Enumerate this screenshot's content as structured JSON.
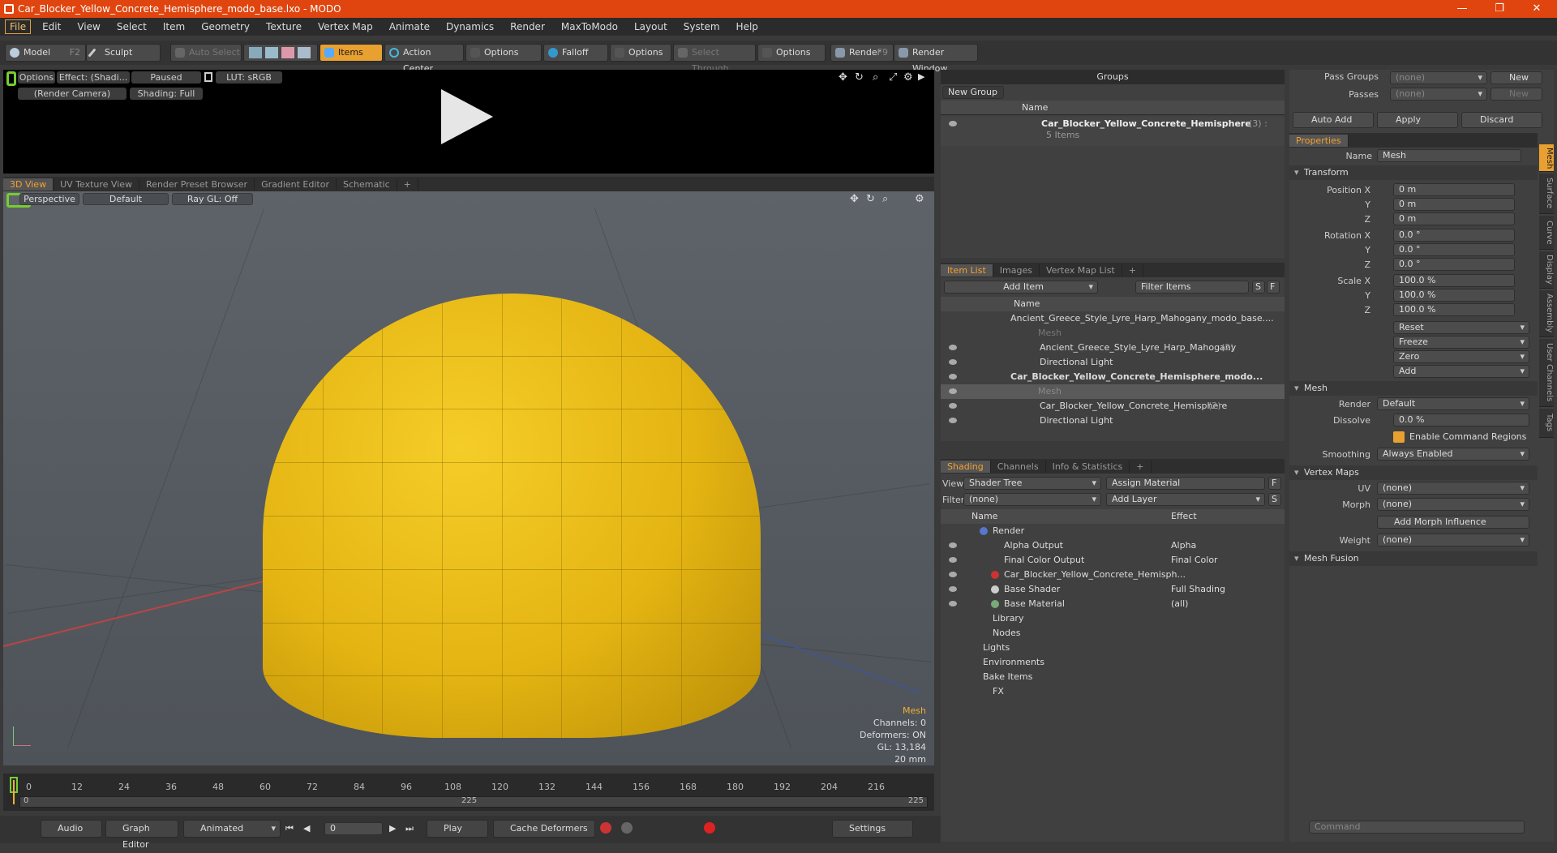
{
  "window": {
    "title": "Car_Blocker_Yellow_Concrete_Hemisphere_modo_base.lxo - MODO",
    "min": "—",
    "max": "❐",
    "close": "✕"
  },
  "menu": [
    "File",
    "Edit",
    "View",
    "Select",
    "Item",
    "Geometry",
    "Texture",
    "Vertex Map",
    "Animate",
    "Dynamics",
    "Render",
    "MaxToModo",
    "Layout",
    "System",
    "Help"
  ],
  "toolbar": {
    "model": "Model",
    "model_key": "F2",
    "sculpt": "Sculpt",
    "auto_select": "Auto Select",
    "items": "Items",
    "action_center": "Action Center",
    "options1": "Options",
    "falloff": "Falloff",
    "options2": "Options",
    "select_through": "Select Through",
    "options3": "Options",
    "render": "Render",
    "render_key": "F9",
    "render_window": "Render Window"
  },
  "preview": {
    "options": "Options",
    "effect": "Effect: (Shadi...",
    "paused": "Paused",
    "lut": "LUT: sRGB",
    "camera": "(Render Camera)",
    "shading": "Shading: Full"
  },
  "view_tabs": [
    "3D View",
    "UV Texture View",
    "Render Preset Browser",
    "Gradient Editor",
    "Schematic",
    "+"
  ],
  "viewport": {
    "perspective": "Perspective",
    "default": "Default",
    "raygl": "Ray GL: Off",
    "info_title": "Mesh",
    "channels": "Channels: 0",
    "deformers": "Deformers: ON",
    "gl": "GL: 13,184",
    "units": "20 mm"
  },
  "timeline": {
    "ticks": [
      "0",
      "12",
      "24",
      "36",
      "48",
      "60",
      "72",
      "84",
      "96",
      "108",
      "120",
      "132",
      "144",
      "156",
      "168",
      "180",
      "192",
      "204",
      "216"
    ],
    "range_start": "0",
    "range_mid": "225",
    "range_end": "225"
  },
  "bottom": {
    "audio": "Audio",
    "graph_editor": "Graph Editor",
    "animated": "Animated",
    "frame": "0",
    "play": "Play",
    "cache": "Cache Deformers",
    "settings": "Settings"
  },
  "groups": {
    "title": "Groups",
    "new_group": "New Group",
    "col_name": "Name",
    "item_name": "Car_Blocker_Yellow_Concrete_Hemisphere",
    "item_count": "(3) :",
    "item_sub": "5 Items"
  },
  "item_list": {
    "tabs": [
      "Item List",
      "Images",
      "Vertex Map List",
      "+"
    ],
    "add_item": "Add Item",
    "filter": "Filter Items",
    "s": "S",
    "f": "F",
    "col_name": "Name",
    "rows": [
      "Ancient_Greece_Style_Lyre_Harp_Mahogany_modo_base....",
      "Mesh",
      "Ancient_Greece_Style_Lyre_Harp_Mahogany",
      "Directional Light",
      "Car_Blocker_Yellow_Concrete_Hemisphere_modo...",
      "Mesh",
      "Car_Blocker_Yellow_Concrete_Hemisphere",
      "Directional Light"
    ],
    "count_a": "(2)",
    "count_b": "(2)"
  },
  "shading": {
    "tabs": [
      "Shading",
      "Channels",
      "Info & Statistics",
      "+"
    ],
    "view_label": "View",
    "view_value": "Shader Tree",
    "assign": "Assign Material",
    "f": "F",
    "filter_label": "Filter",
    "filter_value": "(none)",
    "add_layer": "Add Layer",
    "s": "S",
    "col_name": "Name",
    "col_effect": "Effect",
    "rows": [
      {
        "name": "Render",
        "effect": ""
      },
      {
        "name": "Alpha Output",
        "effect": "Alpha"
      },
      {
        "name": "Final Color Output",
        "effect": "Final Color"
      },
      {
        "name": "Car_Blocker_Yellow_Concrete_Hemisph...",
        "effect": ""
      },
      {
        "name": "Base Shader",
        "effect": "Full Shading"
      },
      {
        "name": "Base Material",
        "effect": "(all)"
      },
      {
        "name": "Library",
        "effect": ""
      },
      {
        "name": "Nodes",
        "effect": ""
      },
      {
        "name": "Lights",
        "effect": ""
      },
      {
        "name": "Environments",
        "effect": ""
      },
      {
        "name": "Bake Items",
        "effect": ""
      },
      {
        "name": "FX",
        "effect": ""
      }
    ]
  },
  "props": {
    "pass_groups": "Pass Groups",
    "passes": "Passes",
    "none": "(none)",
    "new": "New",
    "auto_add": "Auto Add",
    "apply": "Apply",
    "discard": "Discard",
    "tab": "Properties",
    "name_label": "Name",
    "name_value": "Mesh",
    "transform": "Transform",
    "position_x": "Position X",
    "y": "Y",
    "z": "Z",
    "pos": "0 m",
    "rotation_x": "Rotation X",
    "rot": "0.0 °",
    "scale_x": "Scale X",
    "scl": "100.0 %",
    "reset": "Reset",
    "freeze": "Freeze",
    "zero": "Zero",
    "add": "Add",
    "mesh": "Mesh",
    "render_label": "Render",
    "render_value": "Default",
    "dissolve_label": "Dissolve",
    "dissolve_value": "0.0 %",
    "cmd_regions": "Enable Command Regions",
    "smoothing_label": "Smoothing",
    "smoothing_value": "Always Enabled",
    "vertex_maps": "Vertex Maps",
    "uv_label": "UV",
    "morph_label": "Morph",
    "add_morph": "Add Morph Influence",
    "weight_label": "Weight",
    "mesh_fusion": "Mesh Fusion",
    "vtabs": [
      "Mesh",
      "Surface",
      "Curve",
      "Display",
      "Assembly",
      "User Channels",
      "Tags"
    ],
    "command": "Command"
  }
}
